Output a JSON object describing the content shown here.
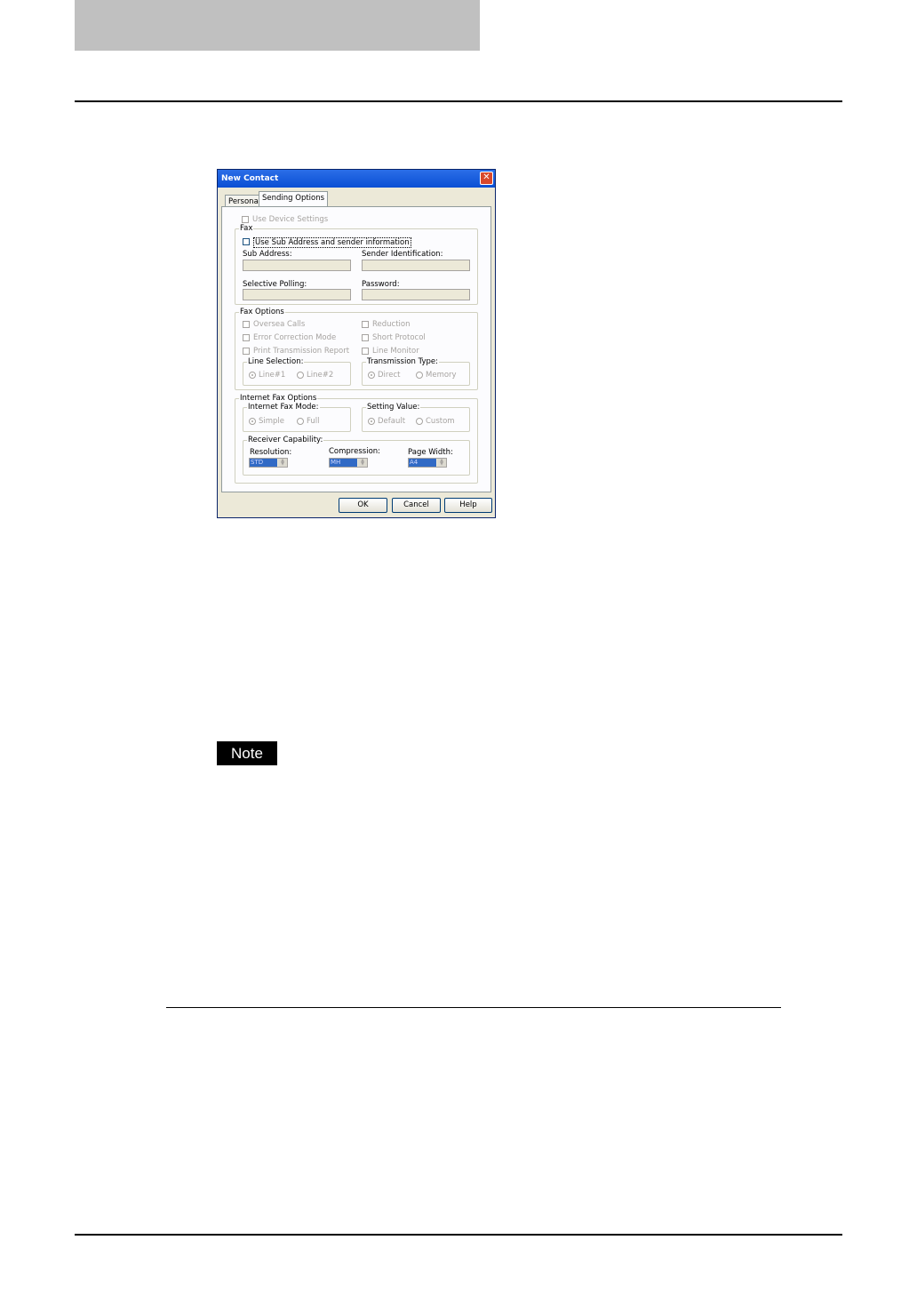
{
  "dialog": {
    "title": "New Contact",
    "close_glyph": "✕",
    "tabs": [
      "Personal",
      "Sending Options"
    ],
    "use_device_settings": "Use Device Settings",
    "fax": {
      "group_title": "Fax",
      "use_sub_address": "Use Sub Address and sender information",
      "sub_address_label": "Sub Address:",
      "sender_id_label": "Sender Identification:",
      "selective_polling_label": "Selective Polling:",
      "password_label": "Password:"
    },
    "fax_options": {
      "group_title": "Fax Options",
      "oversea_calls": "Oversea Calls",
      "ecm": "Error Correction Mode",
      "print_report": "Print Transmission Report",
      "reduction": "Reduction",
      "short_protocol": "Short Protocol",
      "line_monitor": "Line Monitor",
      "line_selection": {
        "title": "Line Selection:",
        "opt1": "Line#1",
        "opt2": "Line#2"
      },
      "transmission_type": {
        "title": "Transmission Type:",
        "opt1": "Direct",
        "opt2": "Memory"
      }
    },
    "internet_fax_options": {
      "group_title": "Internet Fax Options",
      "mode": {
        "title": "Internet Fax Mode:",
        "opt1": "Simple",
        "opt2": "Full"
      },
      "setting_value": {
        "title": "Setting Value:",
        "opt1": "Default",
        "opt2": "Custom"
      },
      "receiver_capability": {
        "title": "Receiver Capability:",
        "resolution_label": "Resolution:",
        "resolution_value": "STD",
        "compression_label": "Compression:",
        "compression_value": "MH",
        "page_width_label": "Page Width:",
        "page_width_value": "A4"
      }
    },
    "buttons": {
      "ok": "OK",
      "cancel": "Cancel",
      "help": "Help"
    }
  },
  "note_badge": "Note"
}
